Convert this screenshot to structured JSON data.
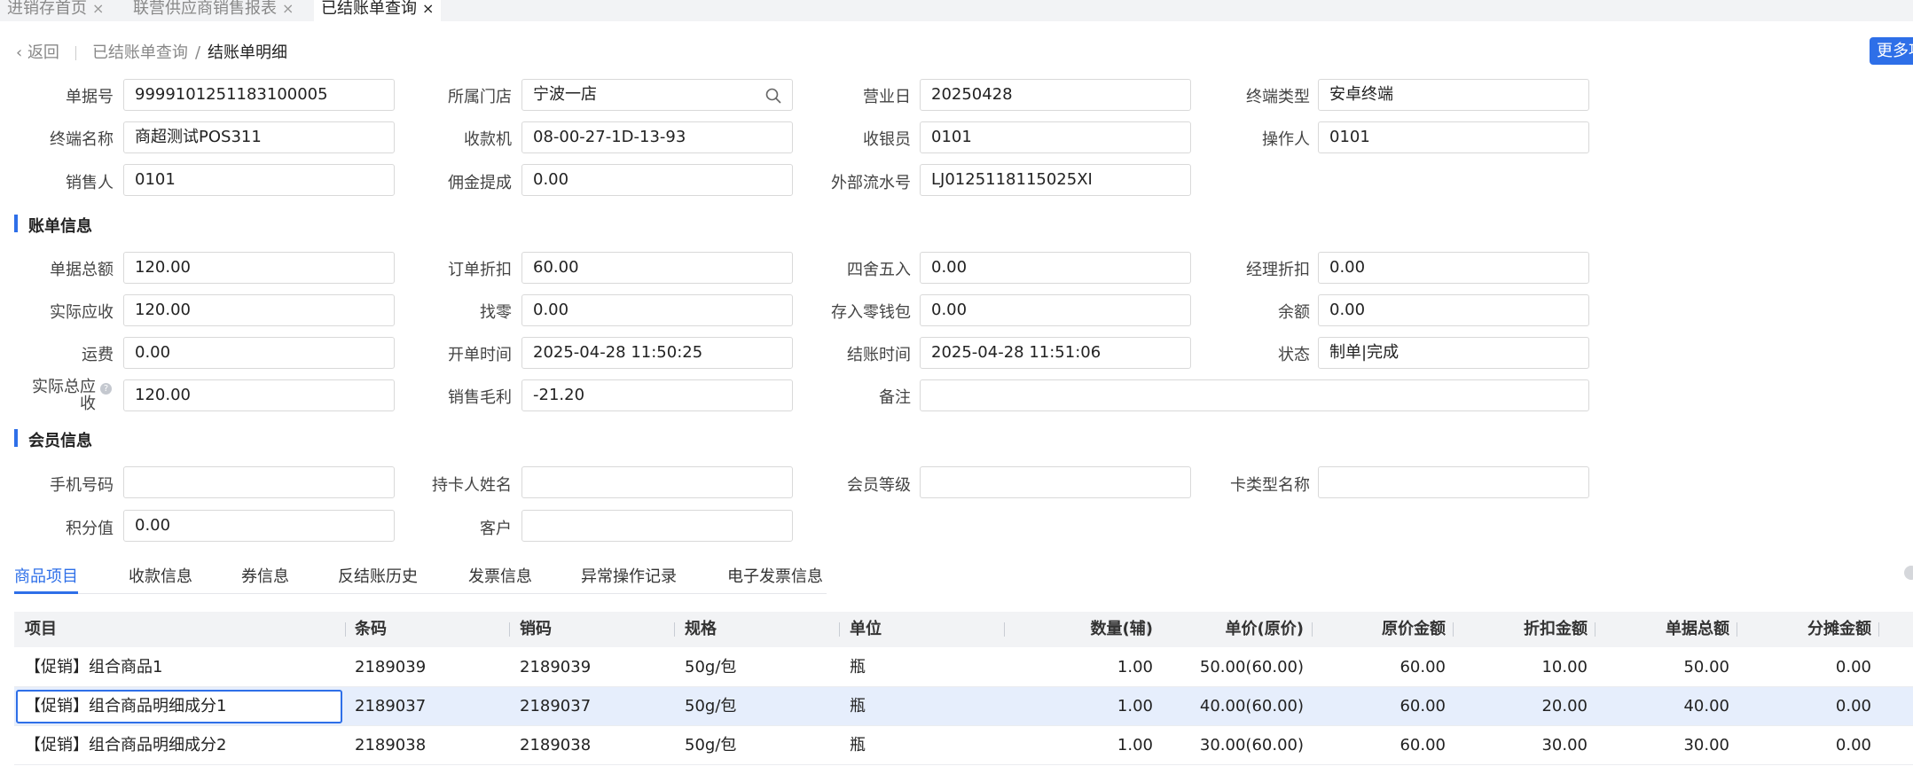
{
  "tabs": [
    {
      "label": "进销存首页",
      "close": "×"
    },
    {
      "label": "联营供应商销售报表",
      "close": "×"
    },
    {
      "label": "已结账单查询",
      "close": "×"
    }
  ],
  "breadcrumb": {
    "back": "返回",
    "parent": "已结账单查询",
    "separator": "/",
    "current": "结账单明细"
  },
  "more_button": "更多项",
  "basic": {
    "doc_no": {
      "label": "单据号",
      "value": "9999101251183100005"
    },
    "store": {
      "label": "所属门店",
      "value": "宁波一店"
    },
    "business_day": {
      "label": "营业日",
      "value": "20250428"
    },
    "terminal_type": {
      "label": "终端类型",
      "value": "安卓终端"
    },
    "terminal_name": {
      "label": "终端名称",
      "value": "商超测试POS311"
    },
    "cash_register": {
      "label": "收款机",
      "value": "08-00-27-1D-13-93"
    },
    "cashier": {
      "label": "收银员",
      "value": "0101"
    },
    "operator": {
      "label": "操作人",
      "value": "0101"
    },
    "salesperson": {
      "label": "销售人",
      "value": "0101"
    },
    "commission": {
      "label": "佣金提成",
      "value": "0.00"
    },
    "external_no": {
      "label": "外部流水号",
      "value": "LJ0125118115025XI"
    }
  },
  "bill": {
    "title": "账单信息",
    "total": {
      "label": "单据总额",
      "value": "120.00"
    },
    "order_discount": {
      "label": "订单折扣",
      "value": "60.00"
    },
    "rounding": {
      "label": "四舍五入",
      "value": "0.00"
    },
    "manager_discount": {
      "label": "经理折扣",
      "value": "0.00"
    },
    "actual_receivable": {
      "label": "实际应收",
      "value": "120.00"
    },
    "change": {
      "label": "找零",
      "value": "0.00"
    },
    "to_wallet": {
      "label": "存入零钱包",
      "value": "0.00"
    },
    "balance": {
      "label": "余额",
      "value": "0.00"
    },
    "freight": {
      "label": "运费",
      "value": "0.00"
    },
    "open_time": {
      "label": "开单时间",
      "value": "2025-04-28 11:50:25"
    },
    "close_time": {
      "label": "结账时间",
      "value": "2025-04-28 11:51:06"
    },
    "status": {
      "label": "状态",
      "value": "制单|完成"
    },
    "actual_total_receivable": {
      "label_line1": "实际总应",
      "label_line2": "收",
      "info": "?",
      "value": "120.00"
    },
    "gross_profit": {
      "label": "销售毛利",
      "value": "-21.20"
    },
    "remark": {
      "label": "备注",
      "value": ""
    }
  },
  "member": {
    "title": "会员信息",
    "phone": {
      "label": "手机号码",
      "value": ""
    },
    "card_holder": {
      "label": "持卡人姓名",
      "value": ""
    },
    "level": {
      "label": "会员等级",
      "value": ""
    },
    "card_type": {
      "label": "卡类型名称",
      "value": ""
    },
    "points": {
      "label": "积分值",
      "value": "0.00"
    },
    "customer": {
      "label": "客户",
      "value": ""
    }
  },
  "subtabs": [
    "商品项目",
    "收款信息",
    "券信息",
    "反结账历史",
    "发票信息",
    "异常操作记录",
    "电子发票信息"
  ],
  "table": {
    "columns": [
      "项目",
      "条码",
      "销码",
      "规格",
      "单位",
      "数量(辅)",
      "单价(原价)",
      "原价金额",
      "折扣金额",
      "单据总额",
      "分摊金额"
    ],
    "rows": [
      [
        "【促销】组合商品1",
        "2189039",
        "2189039",
        "50g/包",
        "瓶",
        "1.00",
        "50.00(60.00)",
        "60.00",
        "10.00",
        "50.00",
        "0.00"
      ],
      [
        "【促销】组合商品明细成分1",
        "2189037",
        "2189037",
        "50g/包",
        "瓶",
        "1.00",
        "40.00(60.00)",
        "60.00",
        "20.00",
        "40.00",
        "0.00"
      ],
      [
        "【促销】组合商品明细成分2",
        "2189038",
        "2189038",
        "50g/包",
        "瓶",
        "1.00",
        "30.00(60.00)",
        "60.00",
        "30.00",
        "30.00",
        "0.00"
      ]
    ]
  },
  "colors": {
    "accent": "#2e6fe8",
    "selected_row": "#e6eefc",
    "header_bg": "#f2f3f5"
  }
}
